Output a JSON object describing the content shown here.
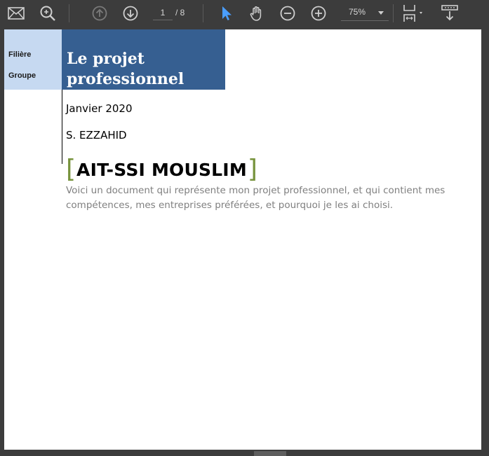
{
  "toolbar": {
    "mail_icon": "mail-icon",
    "search_icon": "search-icon",
    "prev_page_icon": "arrow-up-circle-icon",
    "next_page_icon": "arrow-down-circle-icon",
    "current_page": "1",
    "total_pages": "/ 8",
    "select_tool_icon": "pointer-icon",
    "hand_tool_icon": "hand-icon",
    "zoom_out_icon": "minus-circle-icon",
    "zoom_in_icon": "plus-circle-icon",
    "zoom_value": "75%",
    "fit_icon": "fit-page-icon",
    "more_icon": "download-icon",
    "accent_color": "#4a9eff"
  },
  "document": {
    "side_labels": [
      "Filière",
      "Groupe"
    ],
    "title": "Le projet professionnel",
    "date": "Janvier 2020",
    "author_initials": "S. EZZAHID",
    "bracket_open": "[",
    "name": "AIT-SSI MOUSLIM",
    "bracket_close": "]",
    "abstract": "Voici un document qui représente mon projet professionnel, et qui contient mes compétences, mes entreprises préférées, et pourquoi je les ai choisi.",
    "title_bg": "#365f91",
    "side_bg": "#c6d9f1",
    "bracket_color": "#77933c"
  }
}
